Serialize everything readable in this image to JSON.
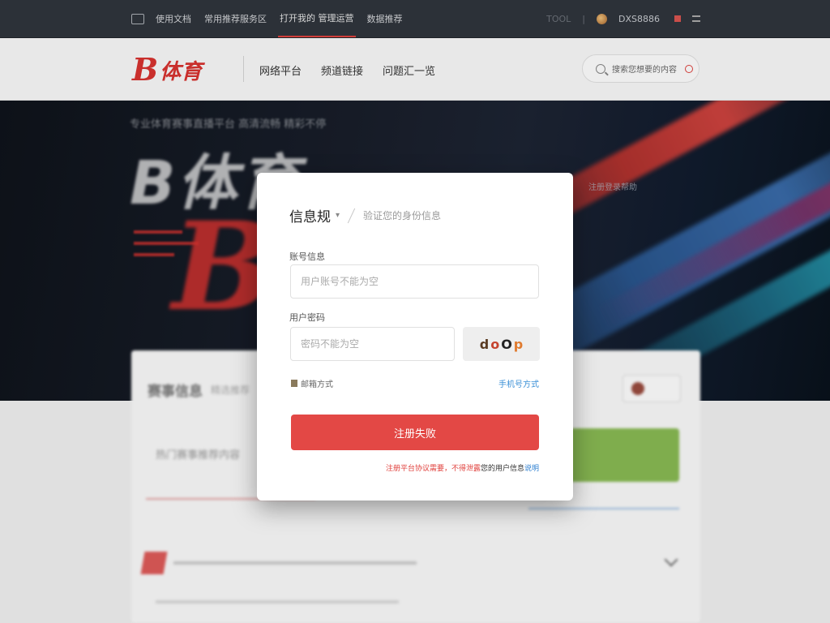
{
  "topbar": {
    "icon": "window-icon",
    "items": [
      "使用文档",
      "常用推荐服务区",
      "打开我的 管理运营",
      "数据推荐"
    ],
    "active_index": 2,
    "right_muted": "TOOL",
    "username": "DXS8886",
    "menu_icon": "menu-icon"
  },
  "header": {
    "logo_letter": "B",
    "logo_text": "体育",
    "nav": [
      "网络平台",
      "频道链接",
      "问题汇一览"
    ],
    "search_placeholder": "搜索您想要的内容"
  },
  "hero": {
    "tagline": "专业体育赛事直播平台 高清流畅 精彩不停",
    "big_title": "B体育",
    "big_letter": "B",
    "side_link": "注册登录帮助"
  },
  "background_card": {
    "title": "赛事信息",
    "subtitle": "精选推荐",
    "row_text": "热门赛事推荐内容"
  },
  "modal": {
    "title": "信息规",
    "title_caret": "▾",
    "subtitle": "验证您的身份信息",
    "username_label": "账号信息",
    "username_placeholder": "用户账号不能为空",
    "password_label": "用户密码",
    "password_placeholder": "密码不能为空",
    "captcha_chars": [
      "d",
      "o",
      "O",
      "p"
    ],
    "option_left": "邮箱方式",
    "option_right": "手机号方式",
    "submit_label": "注册失败",
    "note_red": "注册平台协议需要，不得泄露",
    "note_black": "您的用户信息",
    "note_blue": "说明"
  },
  "colors": {
    "brand_red": "#d8312e",
    "button_red": "#e34845",
    "link_blue": "#3a8fd6",
    "topbar_bg": "#2e333b"
  }
}
